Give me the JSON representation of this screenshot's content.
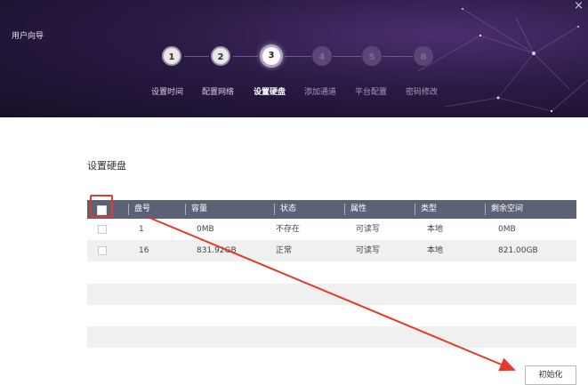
{
  "app": {
    "title": "用户向导",
    "close": "×"
  },
  "steps": [
    {
      "number": "1",
      "label": "设置时间",
      "state": "done"
    },
    {
      "number": "2",
      "label": "配置网络",
      "state": "done"
    },
    {
      "number": "3",
      "label": "设置硬盘",
      "state": "current"
    },
    {
      "number": "4",
      "label": "添加通道",
      "state": "todo"
    },
    {
      "number": "5",
      "label": "平台配置",
      "state": "todo"
    },
    {
      "number": "6",
      "label": "密码修改",
      "state": "todo"
    }
  ],
  "section": {
    "title": "设置硬盘"
  },
  "table": {
    "columns": [
      "盘号",
      "容量",
      "状态",
      "属性",
      "类型",
      "剩余空间"
    ],
    "rows": [
      {
        "num": "1",
        "capacity": "0MB",
        "status": "不存在",
        "attr": "可读写",
        "type": "本地",
        "free": "0MB"
      },
      {
        "num": "16",
        "capacity": "831.92GB",
        "status": "正常",
        "attr": "可读写",
        "type": "本地",
        "free": "821.00GB"
      }
    ]
  },
  "buttons": {
    "initialize": "初始化"
  },
  "colors": {
    "highlight": "#e43a2c",
    "header_bg": "#2a1a44",
    "table_header": "#5b6276"
  }
}
